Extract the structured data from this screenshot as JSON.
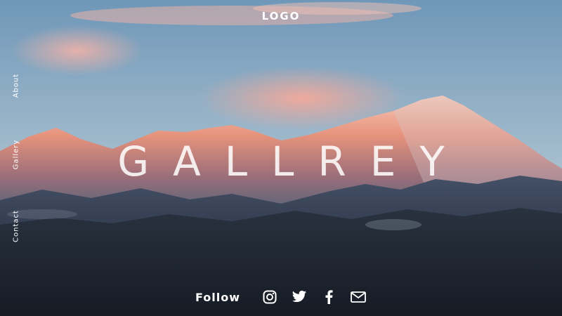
{
  "header": {
    "logo": "LOGO"
  },
  "nav": {
    "items": [
      {
        "label": "About"
      },
      {
        "label": "Gallery"
      },
      {
        "label": "Contact"
      }
    ]
  },
  "hero": {
    "title": "GALLREY"
  },
  "footer": {
    "follow_label": "Follow",
    "social": [
      {
        "icon": "instagram-icon"
      },
      {
        "icon": "twitter-icon"
      },
      {
        "icon": "facebook-icon"
      },
      {
        "icon": "mail-icon"
      }
    ]
  },
  "colors": {
    "sky_top": "#7fa3bf",
    "sky_bottom": "#c7d4d9",
    "peak_glow": "#e9917a",
    "foreground": "#1e2634",
    "text": "#ffffff"
  }
}
